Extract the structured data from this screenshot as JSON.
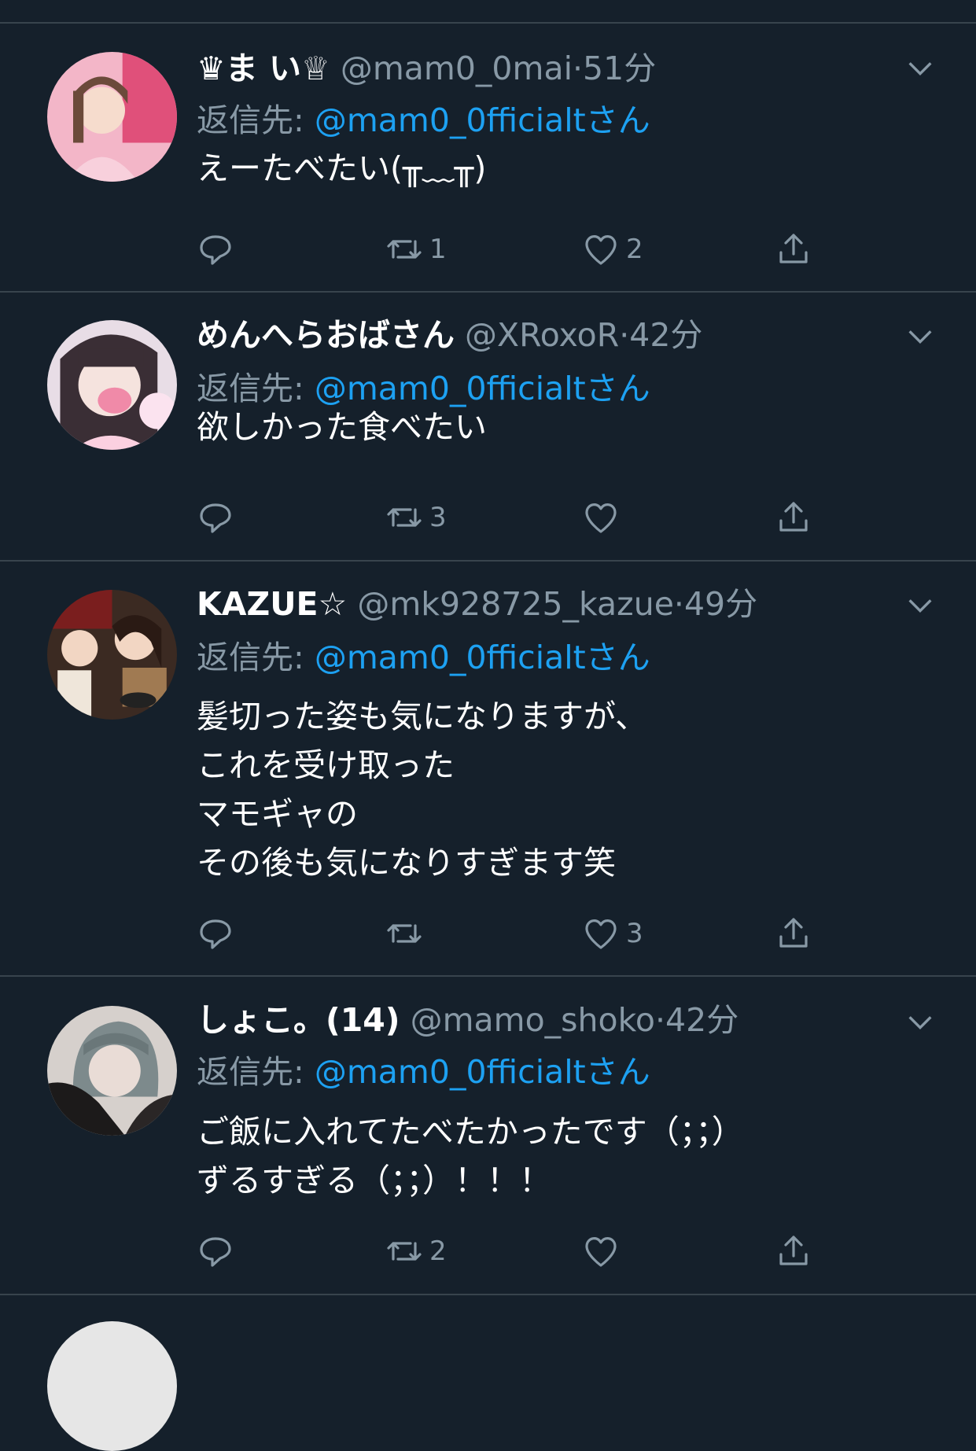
{
  "tweets": [
    {
      "display_name": "♛ま い♕",
      "handle": "@mam0_0mai",
      "time": "51分",
      "reply_prefix": "返信先: ",
      "reply_target": "@mam0_0fficialtさん",
      "body": [
        "えーたべたい(╥﹏╥)"
      ],
      "retweets": "1",
      "likes": "2"
    },
    {
      "display_name": "めんへらおばさん",
      "handle": "@XRoxoR",
      "time": "42分",
      "reply_prefix": "返信先: ",
      "reply_target": "@mam0_0fficialtさん",
      "body": [
        "欲しかった食べたい"
      ],
      "retweets": "3",
      "likes": ""
    },
    {
      "display_name": "KAZUE☆",
      "handle": "@mk928725_kazue",
      "time": "49分",
      "reply_prefix": "返信先: ",
      "reply_target": "@mam0_0fficialtさん",
      "body": [
        "髪切った姿も気になりますが、",
        "これを受け取った",
        "マモギャの",
        "その後も気になりすぎます笑"
      ],
      "retweets": "",
      "likes": "3"
    },
    {
      "display_name": "しょこ。(14)",
      "handle": "@mamo_shoko",
      "time": "42分",
      "reply_prefix": "返信先: ",
      "reply_target": "@mam0_0fficialtさん",
      "body": [
        "ご飯に入れてたべたかったです（；；）",
        "ずるすぎる（；；）！！！"
      ],
      "retweets": "2",
      "likes": ""
    }
  ],
  "separator": "·",
  "colors": {
    "background": "#15202b",
    "divider": "#38444d",
    "secondary_text": "#8899a6",
    "link": "#1da1f2"
  },
  "icons": {
    "reply": "reply-icon",
    "retweet": "retweet-icon",
    "like": "heart-icon",
    "share": "share-icon",
    "more": "chevron-down-icon"
  }
}
